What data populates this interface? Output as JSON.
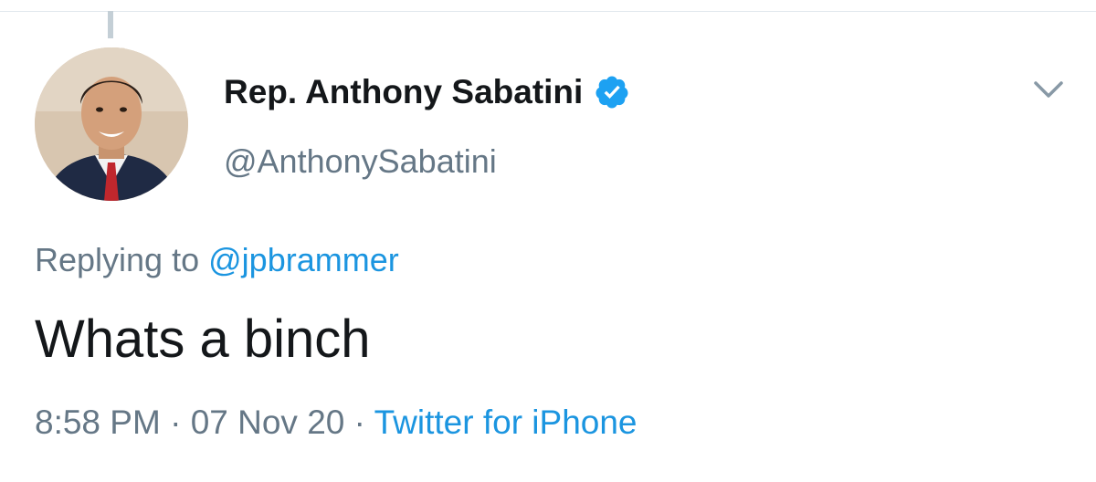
{
  "tweet": {
    "display_name": "Rep. Anthony Sabatini",
    "verified": true,
    "handle": "@AnthonySabatini",
    "replying_to_prefix": "Replying to",
    "replying_to_handle": "@jpbrammer",
    "text": "Whats a binch",
    "time": "8:58 PM",
    "separator": "·",
    "date": "07 Nov 20",
    "source": "Twitter for iPhone"
  },
  "icons": {
    "verified": "verified-badge-icon",
    "more": "chevron-down-icon"
  },
  "colors": {
    "link_blue": "#1b95e0",
    "verified_blue": "#1da1f2",
    "text_primary": "#14171a",
    "text_secondary": "#657786"
  }
}
